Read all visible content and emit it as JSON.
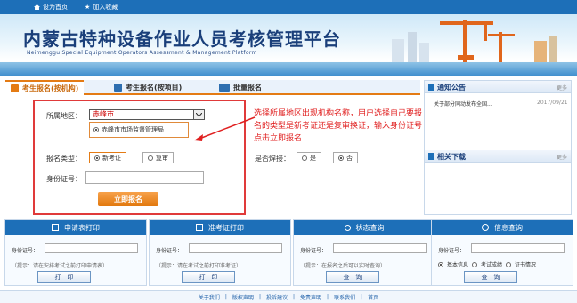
{
  "topbar": {
    "set_home": "设为首页",
    "add_favorite": "加入收藏"
  },
  "banner": {
    "title_cn": "内蒙古特种设备作业人员考核管理平台",
    "title_en": "Neimenggu Special Equipment Operators Assessment & Management Platform"
  },
  "tabs": [
    {
      "label": "考生报名(按机构)"
    },
    {
      "label": "考生报名(按项目)"
    },
    {
      "label": "批量报名"
    }
  ],
  "form": {
    "region_label": "所属地区：",
    "region_value": "赤峰市",
    "org_value": "赤峰市市场监督管理局",
    "type_label": "报名类型：",
    "type_new": "新考证",
    "type_renew": "复审",
    "weld_label": "是否焊接：",
    "weld_yes": "是",
    "weld_no": "否",
    "id_label": "身份证号：",
    "submit_label": "立即报名"
  },
  "annotation": "选择所属地区出现机构名称，用户选择自己要报名的类型是新考证还是复审换证，输入身份证号点击立即报名",
  "notice": {
    "title": "通知公告",
    "more": "更多",
    "item_text": "关于部分同动发布全国...",
    "item_date": "2017/09/21"
  },
  "downloads": {
    "title": "相关下载",
    "more": "更多"
  },
  "panels": [
    {
      "title": "申请表打印",
      "id_label": "身份证号：",
      "hint": "（提示：请在安排考试之前打印申请表）",
      "button": "打　印"
    },
    {
      "title": "准考证打印",
      "id_label": "身份证号：",
      "hint": "（提示：请在考试之前打印准考证）",
      "button": "打　印"
    },
    {
      "title": "状态查询",
      "id_label": "身份证号：",
      "hint": "（提示：在报名之后可以实时查询）",
      "button": "查　询"
    },
    {
      "title": "信息查询",
      "id_label": "身份证号：",
      "opt1": "基本信息",
      "opt2": "考试成绩",
      "opt3": "证书情况",
      "button": "查　询"
    }
  ],
  "footer": {
    "links": [
      "关于我们",
      "版权声明",
      "投诉建议",
      "免责声明",
      "联系我们",
      "首页"
    ]
  },
  "colors": {
    "brand_blue": "#1d6fb8",
    "accent_orange": "#e47b14",
    "annotation_red": "#e02020"
  }
}
